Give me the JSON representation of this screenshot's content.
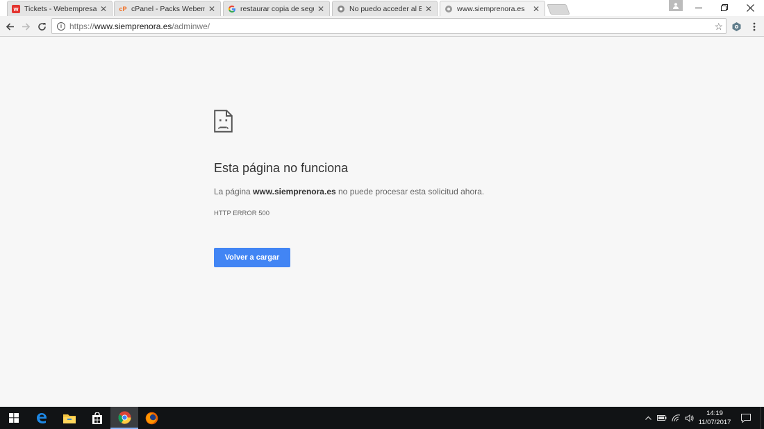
{
  "tabs": [
    {
      "title": "Tickets - Webempresa Eu",
      "favicon": "webempresa-icon",
      "active": false
    },
    {
      "title": "cPanel - Packs Webempresa",
      "favicon": "cpanel-icon",
      "active": false
    },
    {
      "title": "restaurar copia de seguridad",
      "favicon": "google-icon",
      "active": false
    },
    {
      "title": "No puedo acceder al Backend",
      "favicon": "forum-icon",
      "active": false
    },
    {
      "title": "www.siemprenora.es",
      "favicon": "page-icon",
      "active": true
    }
  ],
  "address_bar": {
    "scheme": "https://",
    "host": "www.siemprenora.es",
    "path": "/adminwe/"
  },
  "error_page": {
    "title": "Esta página no funciona",
    "desc_prefix": "La página ",
    "desc_host": "www.siemprenora.es",
    "desc_suffix": " no puede procesar esta solicitud ahora.",
    "code": "HTTP ERROR 500",
    "reload_label": "Volver a cargar"
  },
  "taskbar": {
    "apps": [
      "windows-start-icon",
      "edge-icon",
      "file-explorer-icon",
      "store-icon",
      "chrome-icon",
      "firefox-icon"
    ],
    "active_app": "chrome-icon",
    "time": "14:19",
    "date": "11/07/2017"
  },
  "colors": {
    "accent": "#4285f4",
    "page_bg": "#f7f7f7",
    "taskbar_bg": "#111315"
  }
}
